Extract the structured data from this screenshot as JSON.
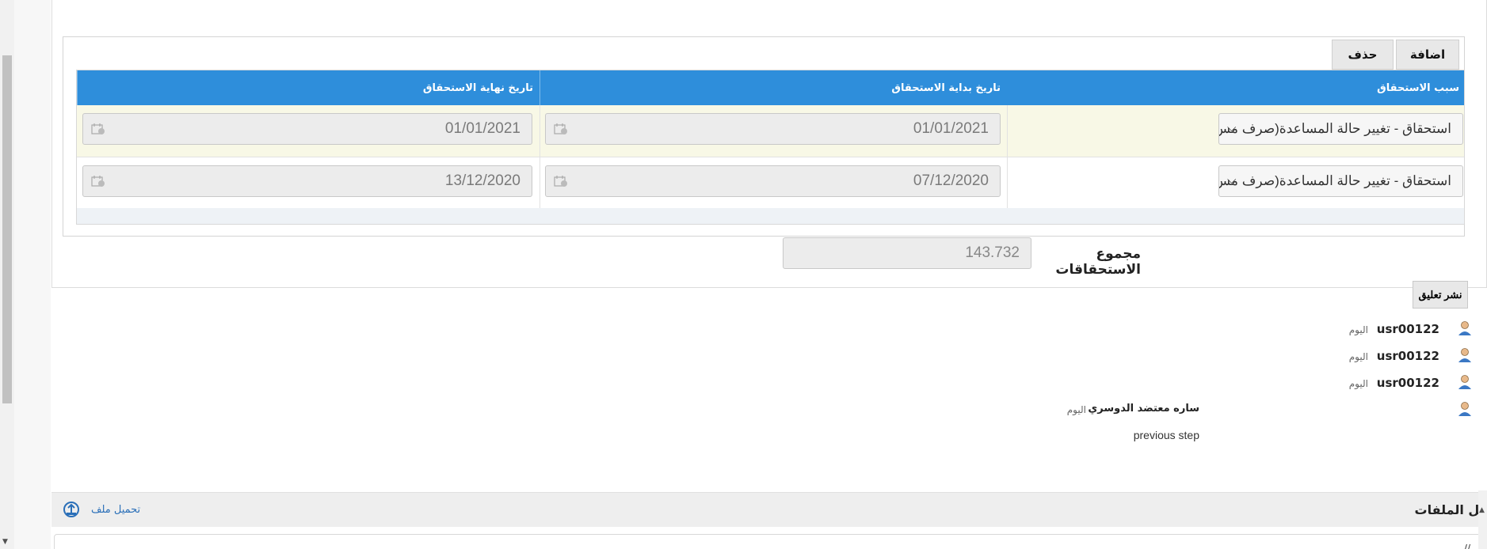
{
  "toolbar": {
    "add_label": "اضافة",
    "delete_label": "حذف"
  },
  "grid": {
    "columns": [
      "سبب الاستحقاق",
      "تاريخ بداية الاستحقاق",
      "تاريخ نهاية الاستحقاق"
    ],
    "rows": [
      {
        "reason": "استحقاق - تغيير حالة المساعدة(صرف مس",
        "start": "01/01/2021",
        "end": "01/01/2021"
      },
      {
        "reason": "استحقاق - تغيير حالة المساعدة(صرف مس",
        "start": "07/12/2020",
        "end": "13/12/2020"
      }
    ]
  },
  "total": {
    "label": "مجموع الاستحقاقات",
    "value": "143.732"
  },
  "comments": {
    "post_label": "نشر تعليق",
    "items": [
      {
        "user": "usr00122",
        "when": "اليوم"
      },
      {
        "user": "usr00122",
        "when": "اليوم"
      },
      {
        "user": "usr00122",
        "when": "اليوم"
      },
      {
        "user": "ساره معتضد الدوسري",
        "when": "اليوم",
        "text": "previous step"
      }
    ]
  },
  "files": {
    "title": "كل الملفات",
    "upload_label": "تحميل ملف",
    "fragment": "//"
  },
  "icons": {
    "calendar": "calendar-icon",
    "chevron": "chevron-down-icon",
    "avatar": "user-avatar-icon",
    "upload": "upload-icon"
  },
  "colors": {
    "header_blue": "#2e8edb",
    "odd_row": "#f8f8e6",
    "link": "#2a6fb8"
  }
}
